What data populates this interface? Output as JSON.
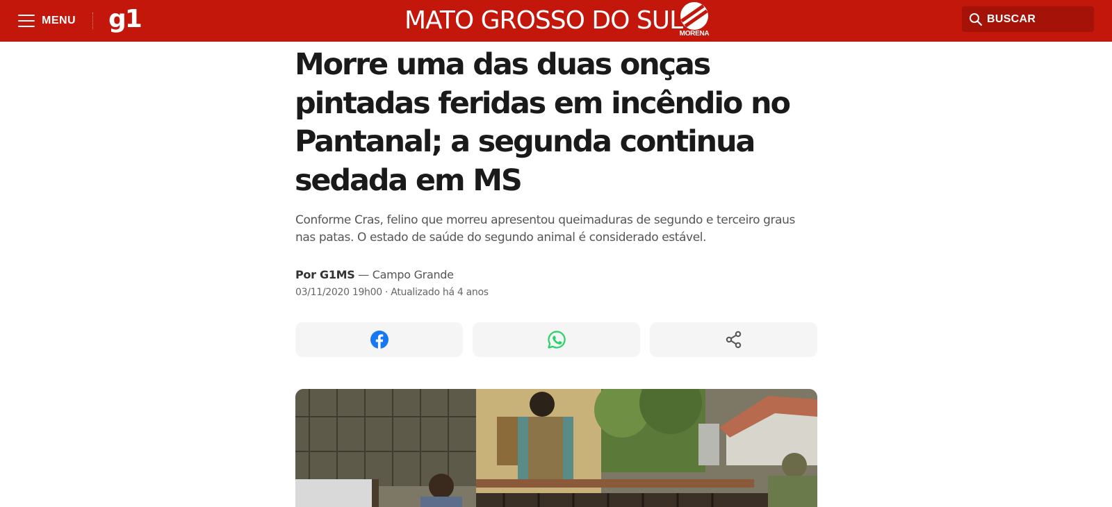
{
  "header": {
    "menu_label": "MENU",
    "logo_text": "g1",
    "region_title": "MATO GROSSO DO SUL",
    "affiliate_name": "MORENA",
    "search_label": "BUSCAR",
    "brand_color": "#c4170c"
  },
  "article": {
    "title": "Morre uma das duas onças pintadas feridas em incêndio no Pantanal; a segunda continua sedada em MS",
    "subtitle": "Conforme Cras, felino que morreu apresentou queimaduras de segundo e terceiro graus nas patas. O estado de saúde do segundo animal é considerado estável.",
    "byline_author": "Por G1MS",
    "byline_location": " — Campo Grande",
    "dateline": "03/11/2020 19h00 · Atualizado há 4 anos"
  },
  "share": {
    "buttons": [
      {
        "icon": "facebook-icon",
        "color": "#1877f2"
      },
      {
        "icon": "whatsapp-icon",
        "color": "#25d366"
      },
      {
        "icon": "share-icon",
        "color": "#555555"
      }
    ]
  }
}
